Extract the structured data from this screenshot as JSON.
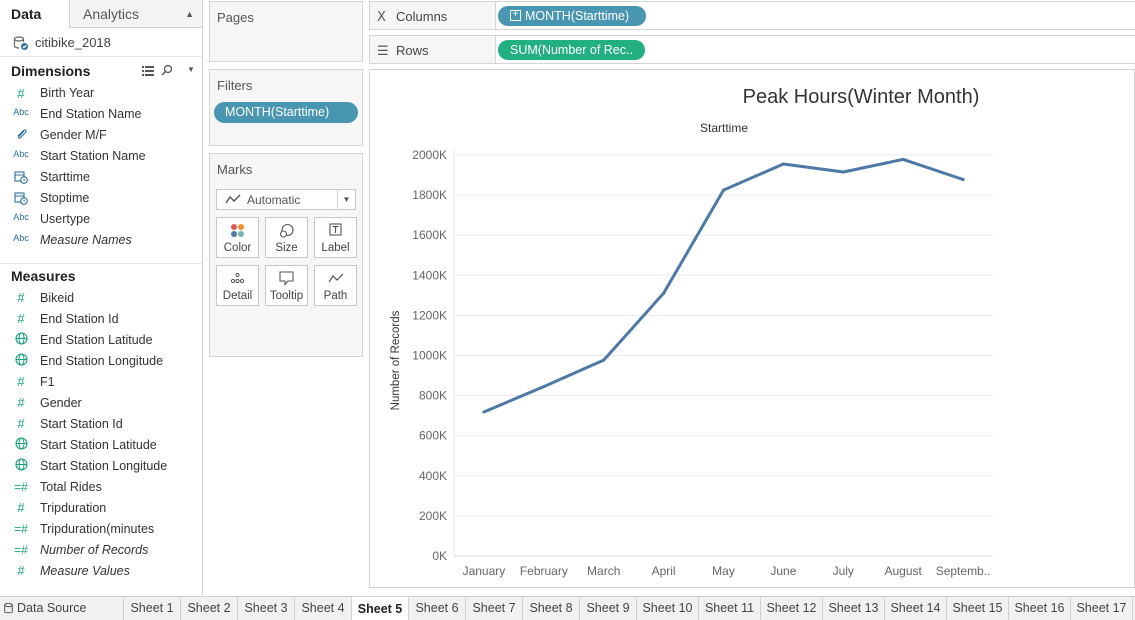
{
  "left_pane": {
    "tabs": {
      "data": "Data",
      "analytics": "Analytics"
    },
    "datasource": "citibike_2018",
    "dimensions_title": "Dimensions",
    "measures_title": "Measures",
    "dimensions": [
      {
        "icon": "#",
        "label": "Birth Year",
        "italic": false
      },
      {
        "icon": "Abc",
        "label": "End Station Name",
        "italic": false
      },
      {
        "icon": "paperclip",
        "label": "Gender M/F",
        "italic": false
      },
      {
        "icon": "Abc",
        "label": "Start Station Name",
        "italic": false
      },
      {
        "icon": "calendar-clock",
        "label": "Starttime",
        "italic": false
      },
      {
        "icon": "calendar-clock",
        "label": "Stoptime",
        "italic": false
      },
      {
        "icon": "Abc",
        "label": "Usertype",
        "italic": false
      },
      {
        "icon": "Abc",
        "label": "Measure Names",
        "italic": true
      }
    ],
    "measures": [
      {
        "icon": "#",
        "label": "Bikeid",
        "italic": false
      },
      {
        "icon": "#",
        "label": "End Station Id",
        "italic": false
      },
      {
        "icon": "globe",
        "label": "End Station Latitude",
        "italic": false
      },
      {
        "icon": "globe",
        "label": "End Station Longitude",
        "italic": false
      },
      {
        "icon": "#",
        "label": "F1",
        "italic": false
      },
      {
        "icon": "#",
        "label": "Gender",
        "italic": false
      },
      {
        "icon": "#",
        "label": "Start Station Id",
        "italic": false
      },
      {
        "icon": "globe",
        "label": "Start Station Latitude",
        "italic": false
      },
      {
        "icon": "globe",
        "label": "Start Station Longitude",
        "italic": false
      },
      {
        "icon": "=#",
        "label": "Total Rides",
        "italic": false
      },
      {
        "icon": "#",
        "label": "Tripduration",
        "italic": false
      },
      {
        "icon": "=#",
        "label": "Tripduration(minutes",
        "italic": false
      },
      {
        "icon": "=#",
        "label": "Number of Records",
        "italic": true
      },
      {
        "icon": "#",
        "label": "Measure Values",
        "italic": true
      }
    ]
  },
  "cards": {
    "pages": "Pages",
    "filters": "Filters",
    "filter_pill": "MONTH(Starttime)",
    "marks": "Marks",
    "mark_type": "Automatic",
    "mark_buttons": [
      "Color",
      "Size",
      "Label",
      "Detail",
      "Tooltip",
      "Path"
    ]
  },
  "shelves": {
    "columns_label": "Columns",
    "rows_label": "Rows",
    "columns_pill": "MONTH(Starttime)",
    "rows_pill": "SUM(Number of Rec.."
  },
  "chart_data": {
    "type": "line",
    "title": "Peak Hours(Winter Month)",
    "x_header": "Starttime",
    "xlabel": "",
    "ylabel": "Number of Records",
    "categories": [
      "January",
      "February",
      "March",
      "April",
      "May",
      "June",
      "July",
      "August",
      "Septemb.."
    ],
    "values": [
      718000,
      845000,
      977000,
      1310000,
      1825000,
      1955000,
      1915000,
      1978000,
      1878000
    ],
    "y_ticks": [
      "0K",
      "200K",
      "400K",
      "600K",
      "800K",
      "1000K",
      "1200K",
      "1400K",
      "1600K",
      "1800K",
      "2000K"
    ],
    "ylim": [
      0,
      2000000
    ],
    "grid": true,
    "line_color": "#4e79a7"
  },
  "bottom_tabs": {
    "datasource": "Data Source",
    "sheets": [
      "Sheet 1",
      "Sheet 2",
      "Sheet 3",
      "Sheet 4",
      "Sheet 5",
      "Sheet 6",
      "Sheet 7",
      "Sheet 8",
      "Sheet 9",
      "Sheet 10",
      "Sheet 11",
      "Sheet 12",
      "Sheet 13",
      "Sheet 14",
      "Sheet 15",
      "Sheet 16",
      "Sheet 17"
    ],
    "active": "Sheet 5"
  }
}
